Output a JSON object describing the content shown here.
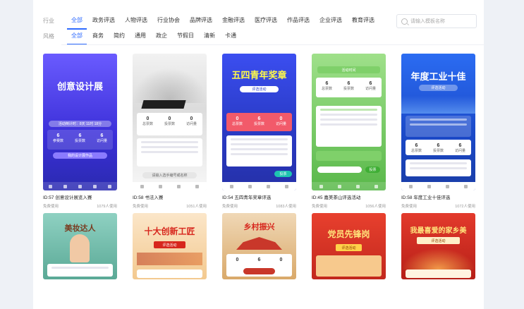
{
  "filters": {
    "industry": {
      "label": "行业",
      "options": [
        "全部",
        "政务评选",
        "人物评选",
        "行业协会",
        "品牌评选",
        "金融评选",
        "医疗评选",
        "作品评选",
        "企业评选",
        "教育评选"
      ]
    },
    "style": {
      "label": "风格",
      "options": [
        "全部",
        "商务",
        "简约",
        "通用",
        "政企",
        "节假日",
        "清新",
        "卡通"
      ]
    }
  },
  "search": {
    "placeholder": "请输入模板名称"
  },
  "cards": [
    {
      "title": "ID:57  创意设计展览入赛",
      "free": "免费使用",
      "uses": "1079人使用",
      "thumb": {
        "banner": "创意设计展",
        "sub": "活动倒计时：8天 11时 18分",
        "stats": [
          {
            "v": "6",
            "l": "参赛数"
          },
          {
            "v": "6",
            "l": "投票数"
          },
          {
            "v": "6",
            "l": "访问量"
          }
        ],
        "button": "我的设计展作品"
      }
    },
    {
      "title": "ID:58  书法入赛",
      "free": "免费使用",
      "uses": "1051人使用",
      "thumb": {
        "banner": "",
        "stats": [
          {
            "v": "0",
            "l": "总票数"
          },
          {
            "v": "0",
            "l": "投票数"
          },
          {
            "v": "0",
            "l": "访问量"
          }
        ],
        "button": "请输入选手编号或名称"
      }
    },
    {
      "title": "ID:54  五四青年奖章评选",
      "free": "免费使用",
      "uses": "1083人使用",
      "thumb": {
        "banner": "五四青年奖章",
        "sub": "评选活动",
        "stats": [
          {
            "v": "0",
            "l": "总票数"
          },
          {
            "v": "6",
            "l": "投票数"
          },
          {
            "v": "0",
            "l": "访问量"
          }
        ],
        "button": "投票"
      }
    },
    {
      "title": "ID:45  嘉美茶山评选活动",
      "free": "免费使用",
      "uses": "1056人使用",
      "thumb": {
        "banner": "",
        "sub": "活动时间",
        "stats": [
          {
            "v": "6",
            "l": "总票数"
          },
          {
            "v": "6",
            "l": "投票数"
          },
          {
            "v": "6",
            "l": "访问量"
          }
        ],
        "button": "投票"
      }
    },
    {
      "title": "ID:58  年度工业十佳评选",
      "free": "免费使用",
      "uses": "1072人使用",
      "thumb": {
        "banner": "年度工业十佳",
        "sub": "评选活动",
        "stats": [
          {
            "v": "6",
            "l": "总票数"
          },
          {
            "v": "6",
            "l": "投票数"
          },
          {
            "v": "6",
            "l": "访问量"
          }
        ],
        "button": ""
      }
    },
    {
      "thumb": {
        "banner": "美妆达人"
      }
    },
    {
      "thumb": {
        "banner": "十大创新工匠",
        "sub": "评选活动"
      }
    },
    {
      "thumb": {
        "banner": "乡村振兴",
        "stats": [
          {
            "v": "0",
            "l": ""
          },
          {
            "v": "6",
            "l": ""
          },
          {
            "v": "0",
            "l": ""
          }
        ]
      }
    },
    {
      "thumb": {
        "banner": "党员先锋岗",
        "sub": "评选活动"
      }
    },
    {
      "thumb": {
        "banner": "我最喜爱的家乡美",
        "sub": "评选活动"
      }
    }
  ],
  "colors": {
    "accent": "#2f6bff"
  }
}
